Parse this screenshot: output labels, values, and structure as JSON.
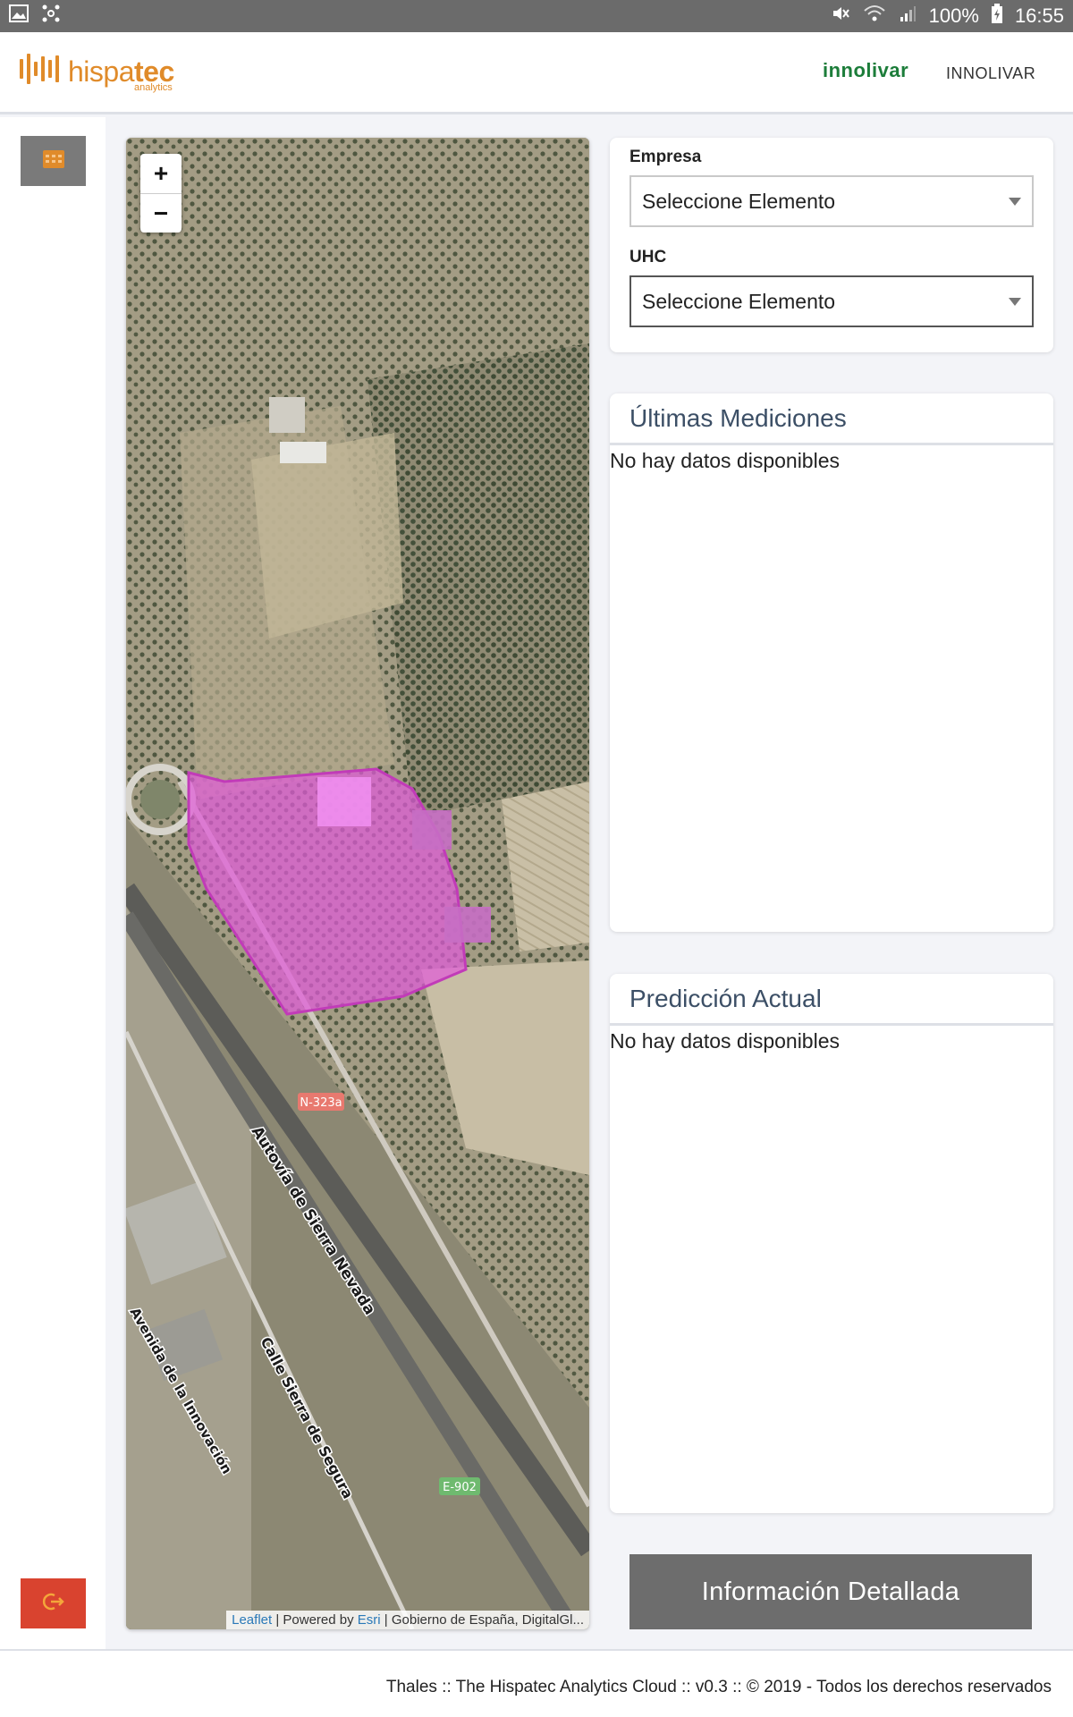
{
  "status_bar": {
    "battery": "100%",
    "time": "16:55",
    "icons_left": [
      "gallery-icon",
      "network-icon"
    ],
    "icons_right": [
      "mute-icon",
      "wifi-icon",
      "signal-icon",
      "battery-icon"
    ]
  },
  "header": {
    "logo_main": "hispa",
    "logo_bold": "tec",
    "logo_sub": "analytics",
    "partner_mark": "innolivar",
    "brand_name": "INNOLIVAR"
  },
  "sidebar": {
    "menu_button_icon": "calendar-grid-icon",
    "logout_button_icon": "logout-icon"
  },
  "map": {
    "zoom_in": "+",
    "zoom_out": "−",
    "road_labels": [
      "N-323a",
      "E-902",
      "Autovía de Sierra Nevada",
      "Calle Sierra de Segura",
      "Avenida de la Innovación"
    ],
    "attribution": {
      "leaflet": "Leaflet",
      "sep1": " | Powered by ",
      "esri": "Esri",
      "rest": " | Gobierno de España, DigitalGl..."
    },
    "polygon_color": "#e15bd8"
  },
  "filters": {
    "empresa_label": "Empresa",
    "empresa_value": "Seleccione Elemento",
    "uhc_label": "UHC",
    "uhc_value": "Seleccione Elemento"
  },
  "mediciones": {
    "title": "Últimas Mediciones",
    "empty": "No hay datos disponibles"
  },
  "prediccion": {
    "title": "Predicción Actual",
    "empty": "No hay datos disponibles"
  },
  "detail_button": "Información Detallada",
  "footer": "Thales :: The Hispatec Analytics Cloud :: v0.3 :: © 2019 - Todos los derechos reservados",
  "colors": {
    "accent_orange": "#e08b2a",
    "logout_red": "#d9432f",
    "button_gray": "#6d6d6d",
    "title_blue": "#3c4f66"
  }
}
